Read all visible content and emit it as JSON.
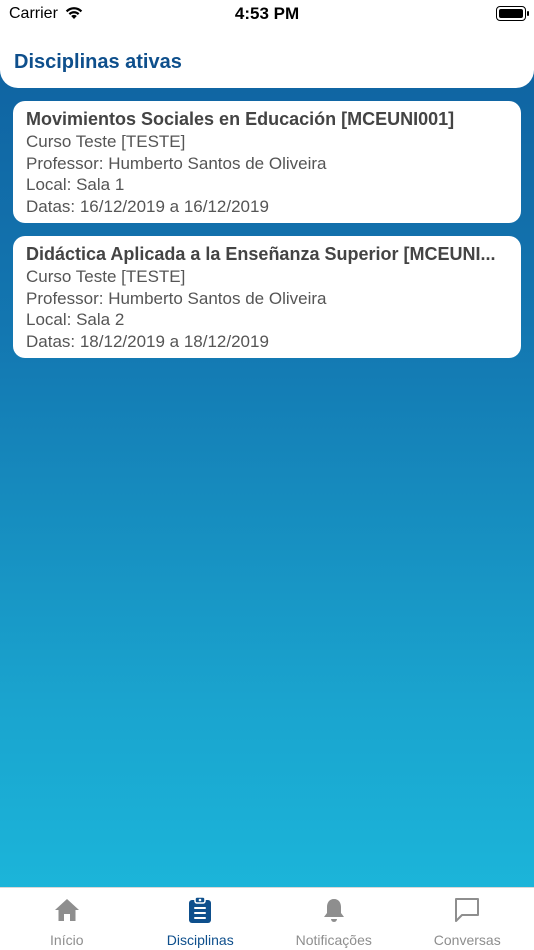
{
  "status_bar": {
    "carrier": "Carrier",
    "time": "4:53 PM"
  },
  "header": {
    "title": "Disciplinas ativas"
  },
  "courses": [
    {
      "title": "Movimientos Sociales en Educación [MCEUNI001]",
      "curso": "Curso Teste [TESTE]",
      "professor": "Professor: Humberto Santos de Oliveira",
      "local": "Local: Sala 1",
      "datas": "Datas: 16/12/2019 a 16/12/2019"
    },
    {
      "title": "Didáctica Aplicada a la Enseñanza Superior [MCEUNI...",
      "curso": "Curso Teste [TESTE]",
      "professor": "Professor: Humberto Santos de Oliveira",
      "local": "Local: Sala 2",
      "datas": "Datas: 18/12/2019 a 18/12/2019"
    }
  ],
  "tab_bar": {
    "tabs": [
      {
        "label": "Início",
        "icon": "home-icon",
        "active": false
      },
      {
        "label": "Disciplinas",
        "icon": "clipboard-icon",
        "active": true
      },
      {
        "label": "Notificações",
        "icon": "bell-icon",
        "active": false
      },
      {
        "label": "Conversas",
        "icon": "chat-icon",
        "active": false
      }
    ],
    "active_color": "#0e4f8c",
    "inactive_color": "#8e8e8e"
  }
}
